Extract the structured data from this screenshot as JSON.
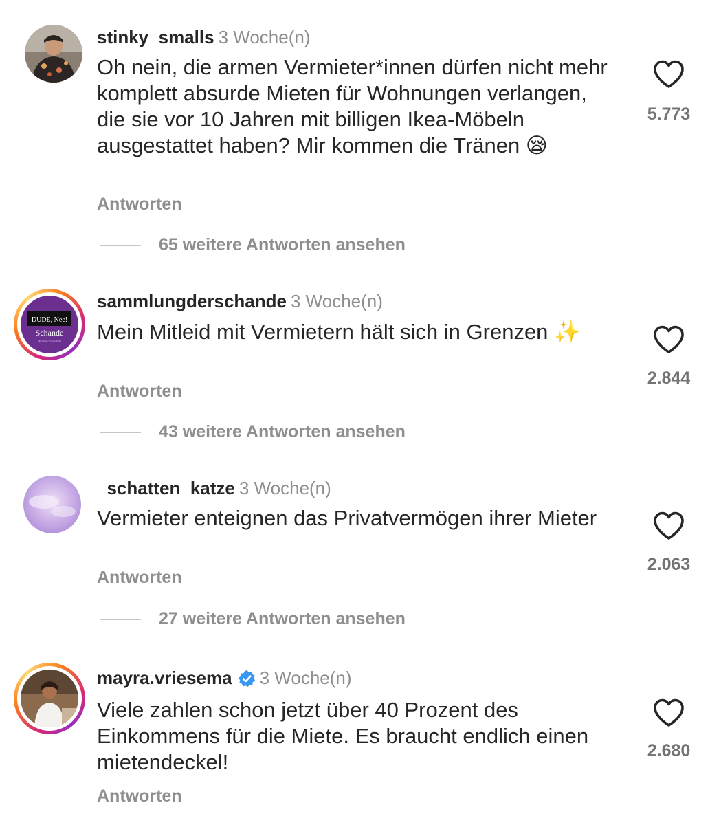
{
  "comments": [
    {
      "username": "stinky_smalls",
      "time": "3 Woche(n)",
      "text": "Oh nein, die armen Vermieter*innen dürfen nicht mehr komplett absurde Mieten für Wohnungen verlangen, die sie vor 10 Jahren mit billigen Ikea-Möbeln ausgestattet haben? Mir kommen die Tränen 😪",
      "reply_label": "Antworten",
      "likes": "5.773",
      "more_replies": "65 weitere Antworten ansehen"
    },
    {
      "username": "sammlungderschande",
      "time": "3 Woche(n)",
      "text": "Mein Mitleid mit Vermietern hält sich in Grenzen ✨",
      "reply_label": "Antworten",
      "likes": "2.844",
      "more_replies": "43 weitere Antworten ansehen",
      "avatar_text": {
        "line1": "DUDE, Nee!",
        "line2": "Schande",
        "line3": "Worten: Schande"
      }
    },
    {
      "username": "_schatten_katze",
      "time": "3 Woche(n)",
      "text": "Vermieter enteignen das Privatvermögen ihrer Mieter",
      "reply_label": "Antworten",
      "likes": "2.063",
      "more_replies": "27 weitere Antworten ansehen"
    },
    {
      "username": "mayra.vriesema",
      "time": "3 Woche(n)",
      "text": "Viele zahlen schon jetzt über 40 Prozent des Einkommens für die Miete. Es braucht endlich einen mietendeckel!",
      "reply_label": "Antworten",
      "likes": "2.680",
      "verified": true
    }
  ],
  "icons": {
    "like": "heart-outline-icon",
    "verified": "verified-badge-icon"
  },
  "colors": {
    "username": "#262626",
    "meta": "#8e8e8e",
    "verified": "#3897f0",
    "story_ring_start": "#d62976",
    "story_ring_end": "#feda75"
  }
}
